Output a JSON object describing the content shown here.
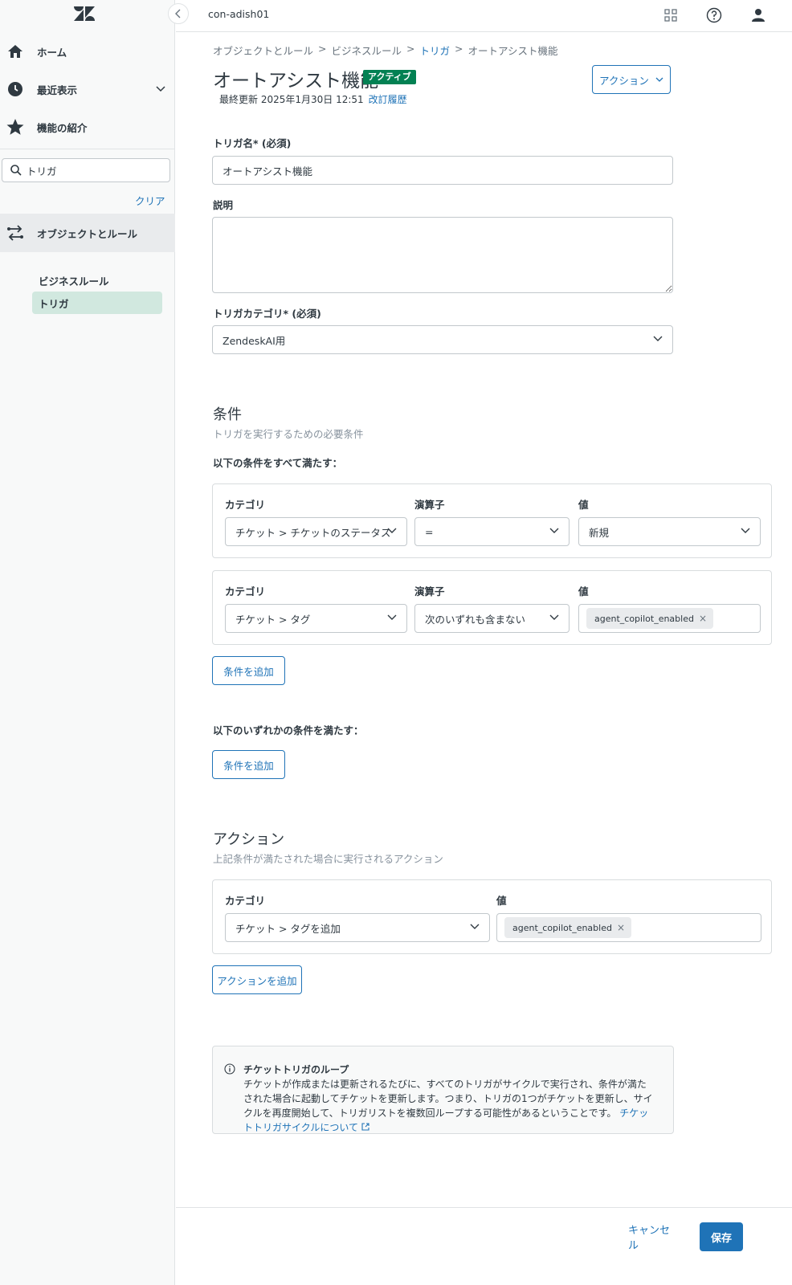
{
  "sidebar": {
    "nav": [
      {
        "label": "ホーム",
        "icon": "home-icon"
      },
      {
        "label": "最近表示",
        "icon": "clock-icon"
      },
      {
        "label": "機能の紹介",
        "icon": "star-icon"
      },
      {
        "label": "オブジェクトとルール",
        "icon": "objects-rules-icon"
      }
    ],
    "search": {
      "value": "トリガ"
    },
    "clear_label": "クリア",
    "sub_heading": "ビジネスルール",
    "sub_item_active": "トリガ"
  },
  "topbar": {
    "instance_name": "con-adish01"
  },
  "breadcrumb": {
    "items": [
      "オブジェクトとルール",
      "ビジネスルール",
      "トリガ",
      "オートアシスト機能"
    ],
    "separator": ">"
  },
  "page": {
    "title": "オートアシスト機能",
    "status": "アクティブ",
    "last_updated": "最終更新 2025年1月30日 12:51",
    "revision_link": "改訂履歴",
    "action_button": "アクション"
  },
  "form": {
    "name_label": "トリガ名* (必須)",
    "name_value": "オートアシスト機能",
    "description_label": "説明",
    "description_value": "",
    "category_label": "トリガカテゴリ* (必須)",
    "category_value": "ZendeskAI用"
  },
  "conditions": {
    "title": "条件",
    "subtitle": "トリガを実行するための必要条件",
    "all_label": "以下の条件をすべて満たす：",
    "any_label": "以下のいずれかの条件を満たす：",
    "col_category": "カテゴリ",
    "col_operator": "演算子",
    "col_value": "値",
    "rows": [
      {
        "category": "チケット > チケットのステータス",
        "operator": "=",
        "value": "新規"
      },
      {
        "category": "チケット > タグ",
        "operator": "次のいずれも含まない",
        "tag": "agent_copilot_enabled"
      }
    ],
    "add_condition": "条件を追加"
  },
  "actions": {
    "title": "アクション",
    "subtitle": "上記条件が満たされた場合に実行されるアクション",
    "col_category": "カテゴリ",
    "col_value": "値",
    "row": {
      "category": "チケット > タグを追加",
      "tag": "agent_copilot_enabled"
    },
    "add_action": "アクションを追加"
  },
  "notice": {
    "title": "チケットトリガのループ",
    "body": "チケットが作成または更新されるたびに、すべてのトリガがサイクルで実行され、条件が満たされた場合に起動してチケットを更新します。つまり、トリガの1つがチケットを更新し、サイクルを再度開始して、トリガリストを複数回ループする可能性があるということです。",
    "link": "チケットトリガサイクルについて"
  },
  "footer": {
    "cancel": "キャンセル",
    "save": "保存"
  },
  "colors": {
    "accent": "#1f73b7",
    "status_green": "#038153",
    "sidebar_bg": "#f8f9f9",
    "active_item_bg": "#d1e8df"
  }
}
